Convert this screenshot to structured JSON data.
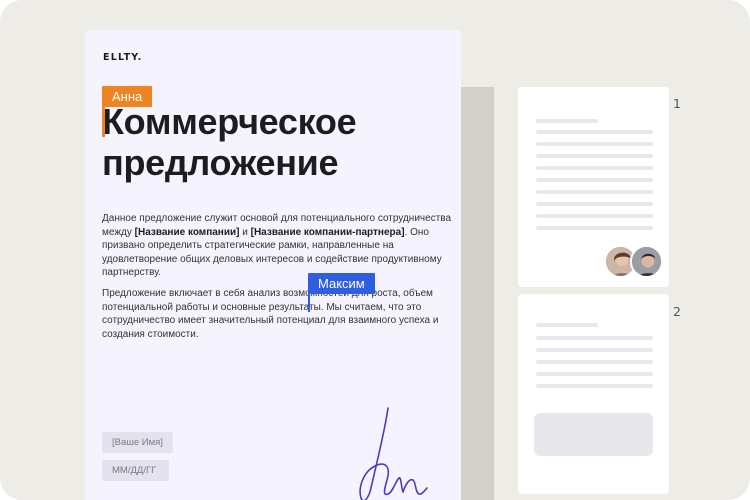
{
  "brand": {
    "logo": "ELLTY."
  },
  "collaborators": {
    "anna": {
      "name": "Анна",
      "color": "#ef8422"
    },
    "maxim": {
      "name": "Максим",
      "color": "#2f5ee0"
    }
  },
  "document": {
    "title": "Коммерческое предложение",
    "para1": {
      "t1": "Данное предложение служит основой для потенциального сотрудничества между ",
      "company": "[Название компании]",
      "t2": " и ",
      "partner": "[Название компании-партнера]",
      "t3": ". Оно призвано определить стратегические рамки, направленные на удовлетворение общих деловых интересов и содействие продуктивному партнерству."
    },
    "para2": "Предложение включает в себя анализ возможностей для роста, объем потенциальной работы и основные результаты. Мы считаем, что это сотрудничество имеет значительный потенциал для взаимного успеха и создания стоимости.",
    "fields": {
      "name_placeholder": "[Ваше Имя]",
      "date_placeholder": "ММ/ДД/ГГ"
    },
    "signature_color": "#4b3fb8"
  },
  "thumbnails": {
    "pages": [
      {
        "number": "1"
      },
      {
        "number": "2"
      }
    ]
  },
  "colors": {
    "background": "#eeece6",
    "page": "#f5f3fd"
  }
}
